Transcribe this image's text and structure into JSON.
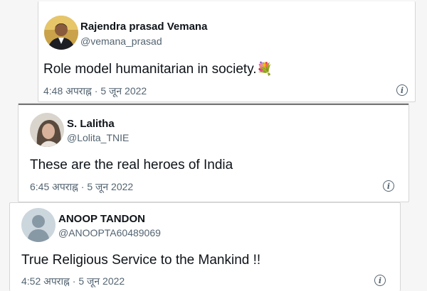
{
  "tweets": [
    {
      "name": "Rajendra prasad Vemana",
      "handle": "@vemana_prasad",
      "text": "Role model humanitarian in society.",
      "emoji": "💐",
      "time": "4:48 अपराह्न",
      "separator": "·",
      "date": "5 जून 2022"
    },
    {
      "name": "S. Lalitha",
      "handle": "@Lolita_TNIE",
      "text": "These are the real heroes of India",
      "time": "6:45 अपराह्न",
      "separator": "·",
      "date": "5 जून 2022"
    },
    {
      "name": "ANOOP TANDON",
      "handle": "@ANOOPTA60489069",
      "text": "True Religious Service to the Mankind !!",
      "time": "4:52 अपराह्न",
      "separator": "·",
      "date": "5 जून 2022"
    }
  ],
  "icons": {
    "info": "info-icon",
    "bouquet": "bouquet-emoji"
  },
  "colors": {
    "text_primary": "#0f1419",
    "text_secondary": "#536471",
    "card_bg": "#ffffff",
    "border": "#d6d6d6"
  }
}
